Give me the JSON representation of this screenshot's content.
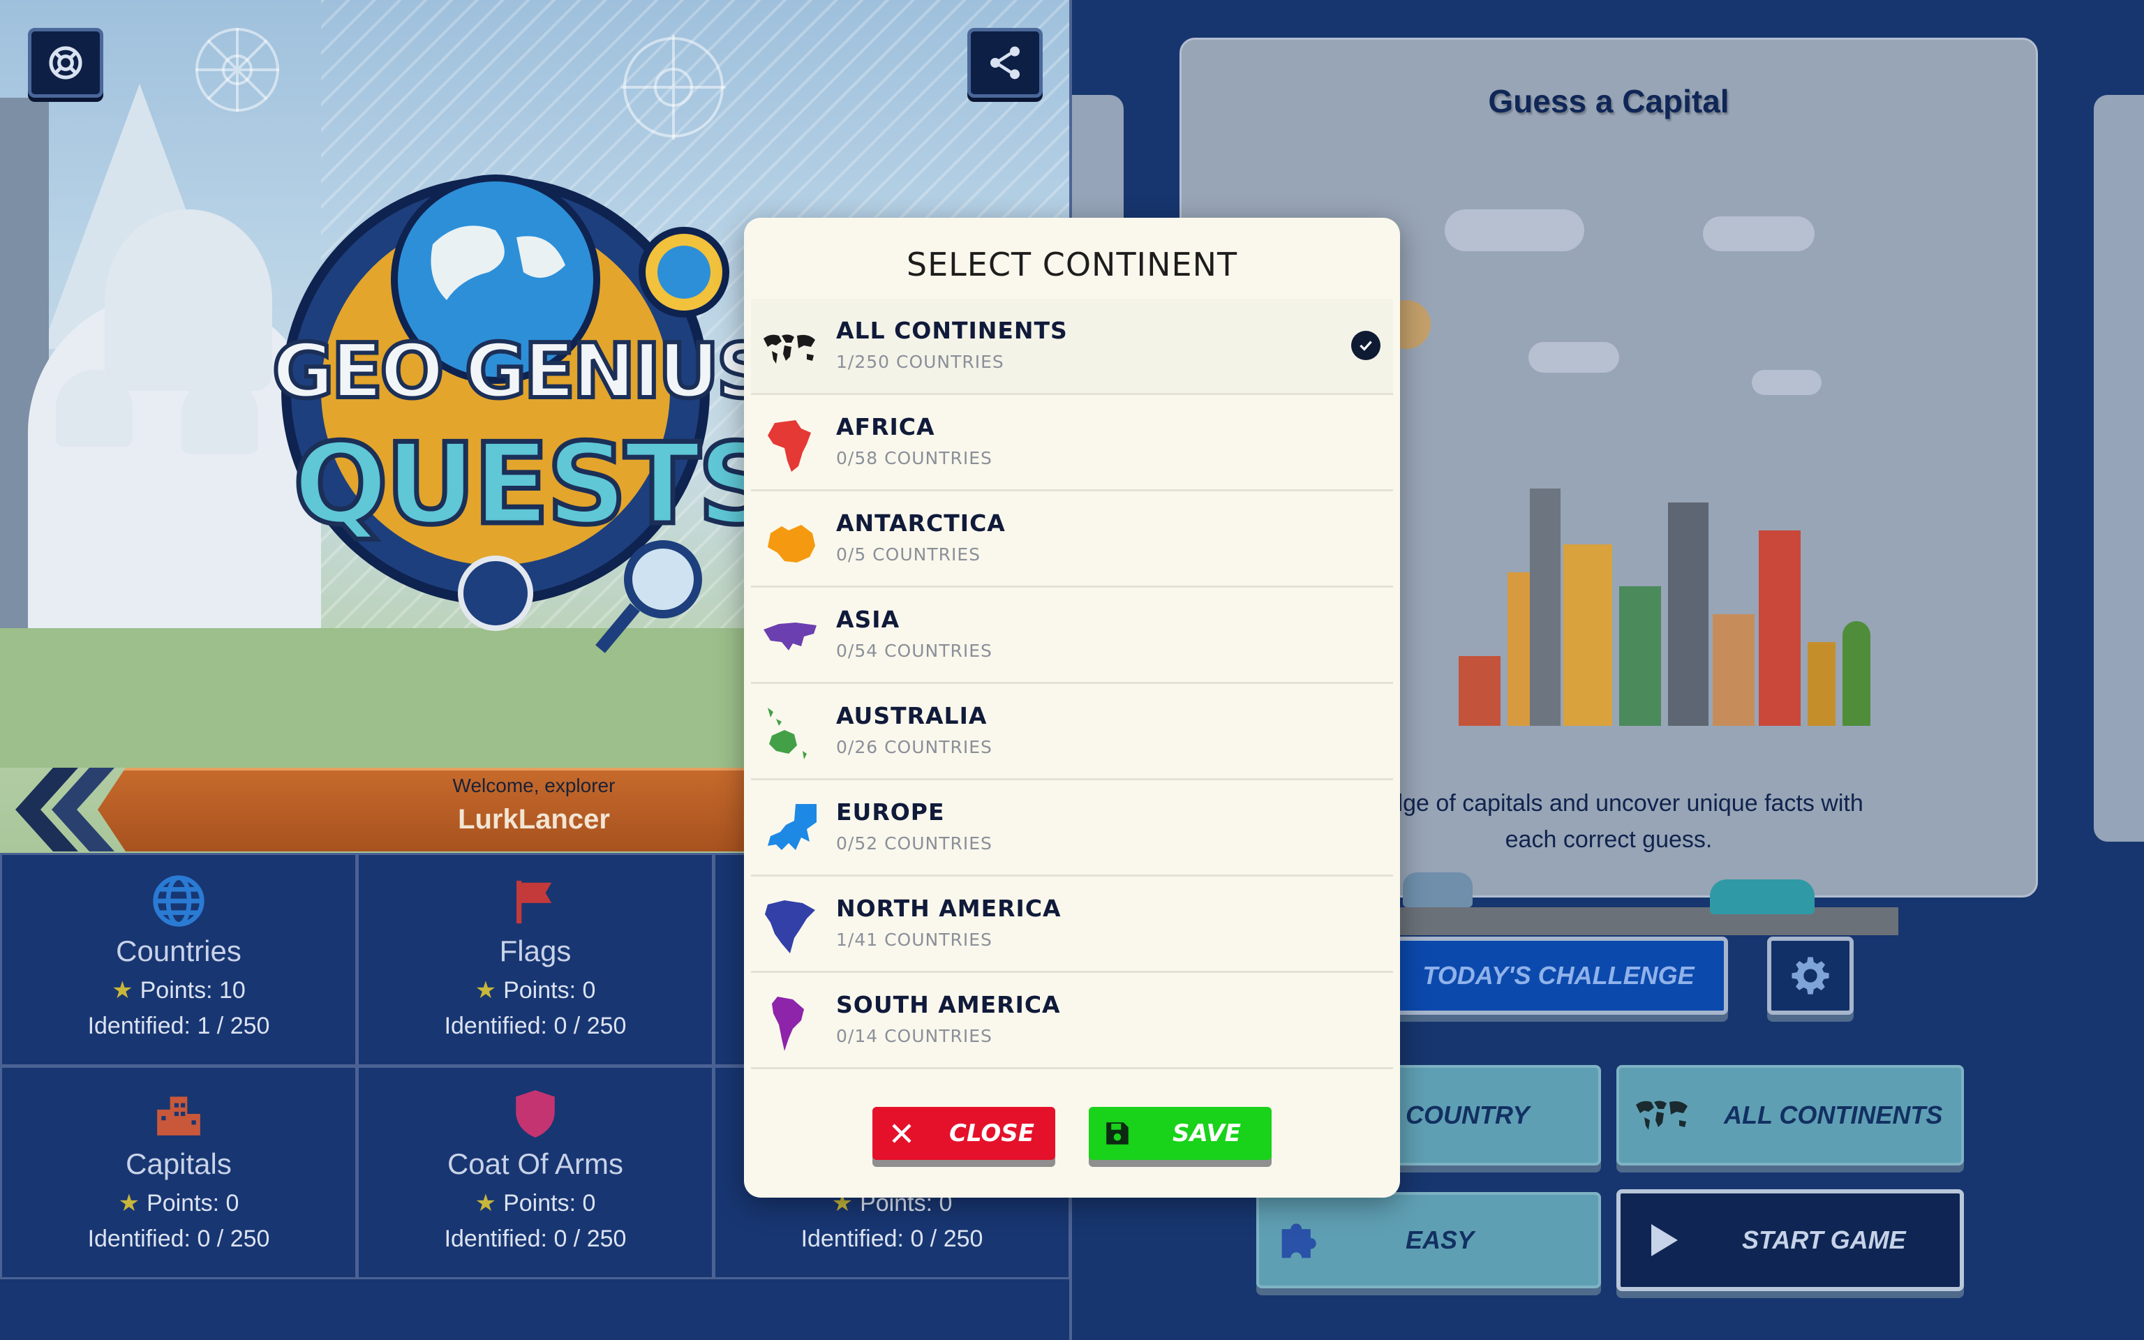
{
  "left": {
    "logo_line1": "GEO GENIUS",
    "logo_line2": "QUESTS",
    "welcome": "Welcome, explorer",
    "player_name": "LurkLancer",
    "stats": [
      {
        "title": "Countries",
        "points": "Points: 10",
        "identified": "Identified: 1 / 250",
        "icon": "globe-icon",
        "color": "#2a7bd4"
      },
      {
        "title": "Flags",
        "points": "Points: 0",
        "identified": "Identified: 0 / 250",
        "icon": "flag-icon",
        "color": "#c43a3a"
      },
      {
        "title": "",
        "points": "",
        "identified": "",
        "icon": "",
        "color": ""
      },
      {
        "title": "Capitals",
        "points": "Points: 0",
        "identified": "Identified: 0 / 250",
        "icon": "city-icon",
        "color": "#c9583a"
      },
      {
        "title": "Coat Of Arms",
        "points": "Points: 0",
        "identified": "Identified: 0 / 250",
        "icon": "shield-icon",
        "color": "#c43470"
      },
      {
        "title": "",
        "points": "Points: 0",
        "identified": "Identified: 0 / 250",
        "icon": "",
        "color": ""
      }
    ]
  },
  "right": {
    "card_title": "Guess a Capital",
    "card_desc_line1": "wledge of capitals and uncover unique facts with",
    "card_desc_line2": "each correct guess.",
    "today_challenge": "TODAY'S CHALLENGE",
    "mode_country": "COUNTRY",
    "continent_button": "ALL CONTINENTS",
    "difficulty": "EASY",
    "start_game": "START GAME"
  },
  "modal": {
    "title": "SELECT CONTINENT",
    "continents": [
      {
        "name": "ALL CONTINENTS",
        "count": "1/250 COUNTRIES",
        "color": "#1a1a1a",
        "selected": true
      },
      {
        "name": "AFRICA",
        "count": "0/58 COUNTRIES",
        "color": "#e53935"
      },
      {
        "name": "ANTARCTICA",
        "count": "0/5 COUNTRIES",
        "color": "#f59a10"
      },
      {
        "name": "ASIA",
        "count": "0/54 COUNTRIES",
        "color": "#6b3fb0"
      },
      {
        "name": "AUSTRALIA",
        "count": "0/26 COUNTRIES",
        "color": "#43a047"
      },
      {
        "name": "EUROPE",
        "count": "0/52 COUNTRIES",
        "color": "#1e88e5"
      },
      {
        "name": "NORTH AMERICA",
        "count": "1/41 COUNTRIES",
        "color": "#3340a8"
      },
      {
        "name": "SOUTH AMERICA",
        "count": "0/14 COUNTRIES",
        "color": "#8e24aa"
      }
    ],
    "close_label": "CLOSE",
    "save_label": "SAVE"
  },
  "colors": {
    "background": "#183672",
    "modal": "#faf8ec",
    "close": "#e5112b",
    "save": "#19d21a",
    "accent_blue": "#0c49ad"
  }
}
